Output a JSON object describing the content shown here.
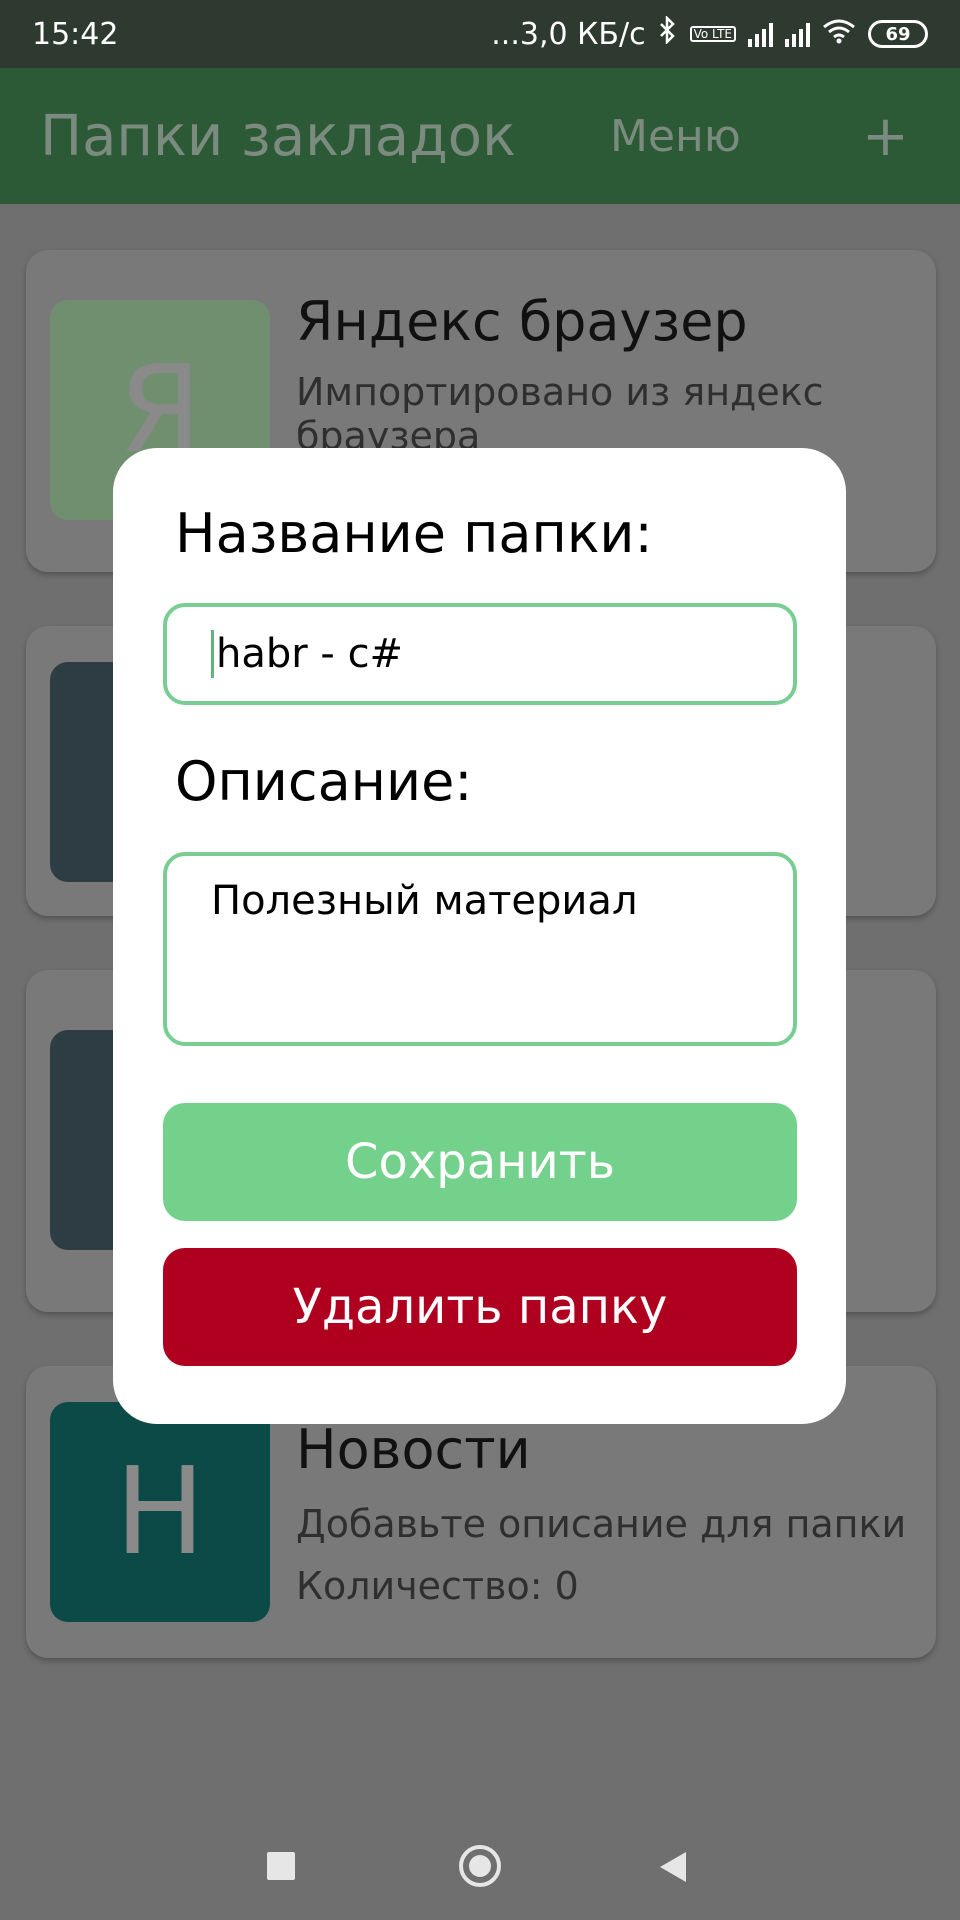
{
  "status_bar": {
    "time": "15:42",
    "network_speed": "...3,0 КБ/с",
    "lte_badge": "Vo LTE",
    "battery": "69",
    "icons": [
      "bluetooth-icon",
      "signal-icon",
      "wifi-icon",
      "battery-icon"
    ]
  },
  "app_bar": {
    "title": "Папки закладок",
    "menu_label": "Меню",
    "add_label": "+"
  },
  "cards": [
    {
      "letter": "Я",
      "title": "Яндекс браузер",
      "description": "Импортировано из яндекс браузера",
      "thumb_color": "#6f8f6f"
    },
    {
      "letter": "",
      "title": "",
      "description": "",
      "thumb_color": "#2e3c43"
    },
    {
      "letter": "",
      "title": "",
      "description": "",
      "thumb_color": "#2e3c43"
    },
    {
      "letter": "Н",
      "title": "Новости",
      "description": "Добавьте описание для папки",
      "count": "Количество: 0",
      "thumb_color": "#0b4a47"
    }
  ],
  "dialog": {
    "name_label": "Название папки:",
    "name_value": "habr - c#",
    "description_label": "Описание:",
    "description_value": "Полезный материал",
    "save_label": "Сохранить",
    "delete_label": "Удалить папку",
    "accent_color": "#74d18c",
    "danger_color": "#b00020"
  },
  "nav_bar": {
    "icons": [
      "recent-apps-icon",
      "home-icon",
      "back-icon"
    ]
  }
}
